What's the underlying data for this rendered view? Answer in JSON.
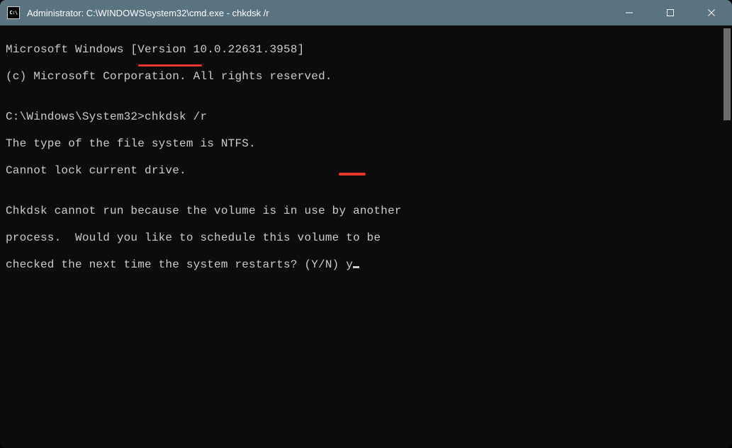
{
  "titlebar": {
    "icon_text": "C:\\",
    "title": "Administrator: C:\\WINDOWS\\system32\\cmd.exe - chkdsk  /r"
  },
  "terminal": {
    "line1": "Microsoft Windows [Version 10.0.22631.3958]",
    "line2": "(c) Microsoft Corporation. All rights reserved.",
    "blank1": "",
    "prompt_line": "C:\\Windows\\System32>chkdsk /r",
    "line3": "The type of the file system is NTFS.",
    "line4": "Cannot lock current drive.",
    "blank2": "",
    "line5": "Chkdsk cannot run because the volume is in use by another",
    "line6": "process.  Would you like to schedule this volume to be",
    "line7_pre": "checked the next time the system restarts? (Y/N) y"
  }
}
